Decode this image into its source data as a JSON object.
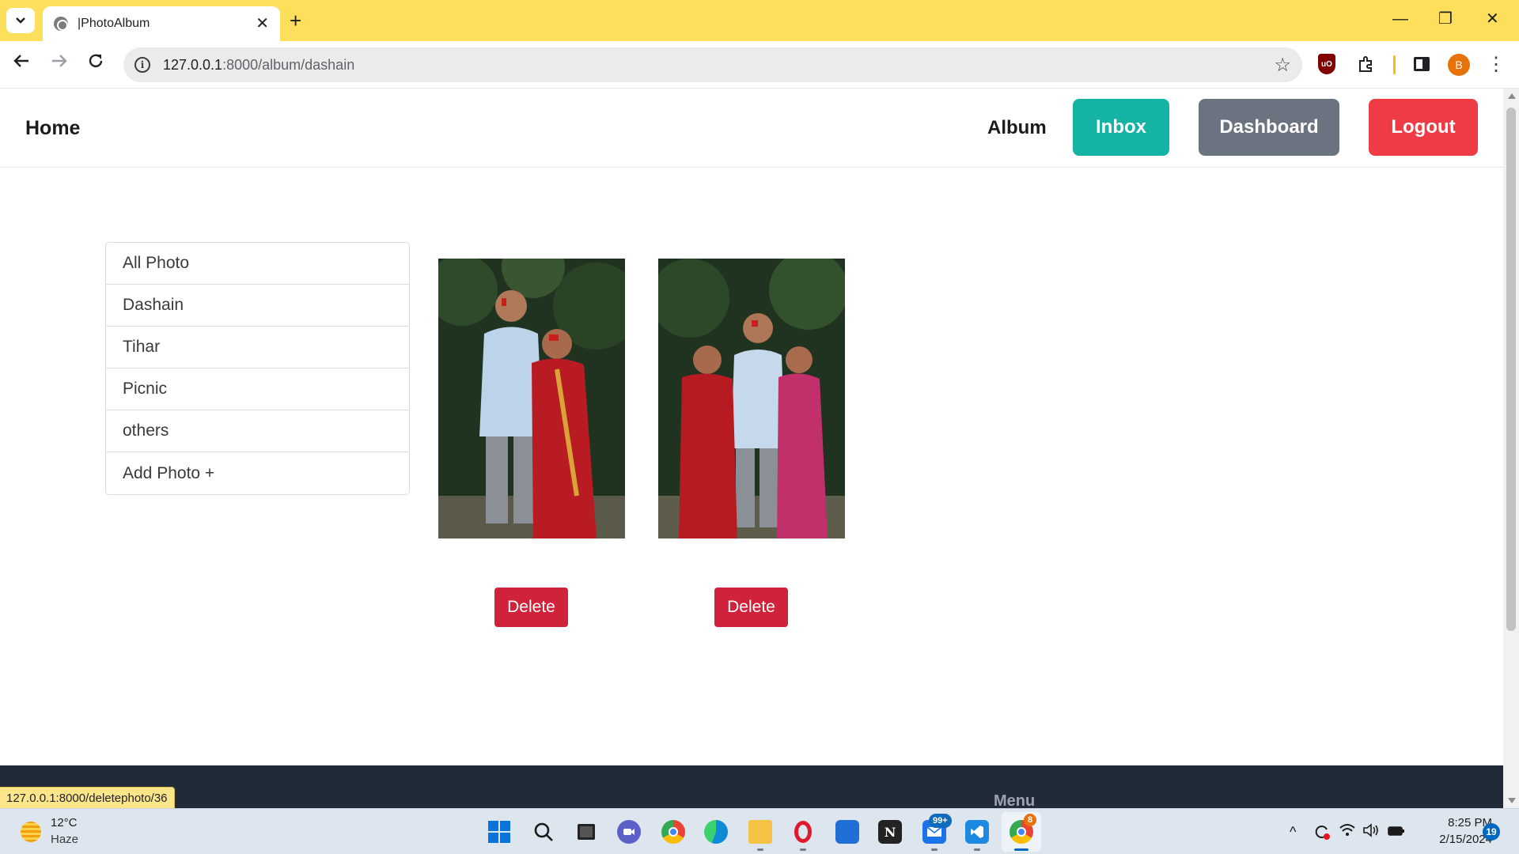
{
  "browser": {
    "tab_title": "|PhotoAlbum",
    "tab_close": "✕",
    "new_tab": "+",
    "url_host": "127.0.0.1",
    "url_path": ":8000/album/dashain",
    "window_controls": {
      "minimize": "—",
      "restore": "❐",
      "close": "✕"
    },
    "profile_initial": "B",
    "ublock_label": "uO",
    "status_url": "127.0.0.1:8000/deletephoto/36"
  },
  "navbar": {
    "brand": "Home",
    "album_link": "Album",
    "inbox_btn": "Inbox",
    "dashboard_btn": "Dashboard",
    "logout_btn": "Logout",
    "colors": {
      "inbox": "#15b3a3",
      "dashboard": "#6b7280",
      "logout": "#ef3b45"
    }
  },
  "sidebar": {
    "items": [
      {
        "label": "All Photo"
      },
      {
        "label": "Dashain"
      },
      {
        "label": "Tihar"
      },
      {
        "label": "Picnic"
      },
      {
        "label": "others"
      },
      {
        "label": "Add Photo +"
      }
    ]
  },
  "photos": [
    {
      "delete_label": "Delete"
    },
    {
      "delete_label": "Delete"
    }
  ],
  "footer": {
    "menu_heading": "Menu"
  },
  "taskbar": {
    "weather_temp": "12°C",
    "weather_desc": "Haze",
    "mail_badge": "99+",
    "chrome_badge": "8",
    "notion_letter": "N",
    "time": "8:25 PM",
    "date": "2/15/2024",
    "notification_count": "19"
  }
}
